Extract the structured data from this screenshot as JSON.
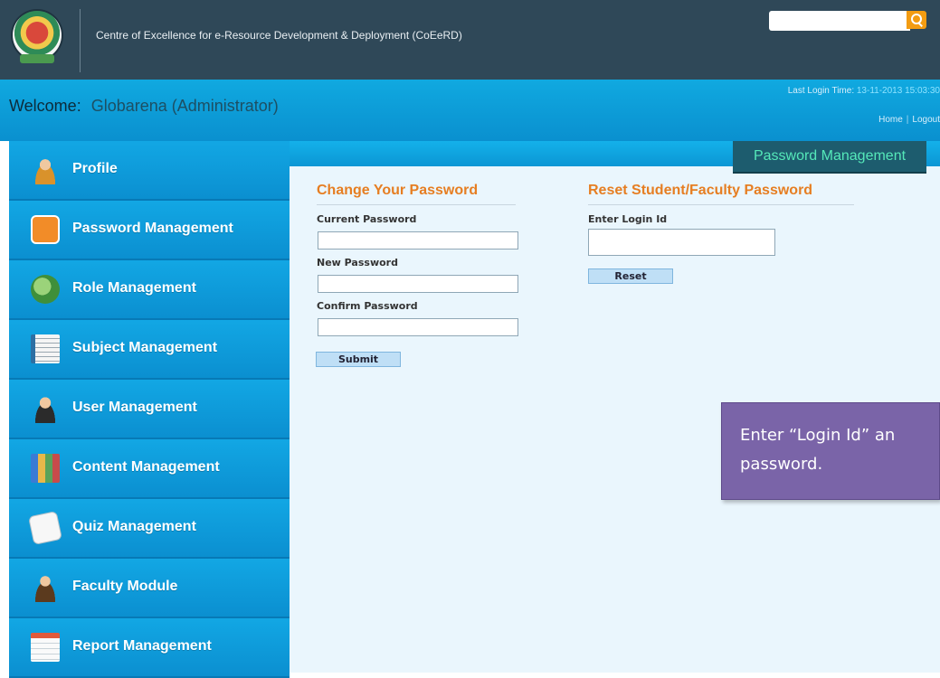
{
  "header": {
    "site_title": "Centre of Excellence for e-Resource Development & Deployment (CoEeRD)",
    "search_placeholder": "",
    "search_icon": "magnifier-icon",
    "logo_icon": "university-seal-icon"
  },
  "welcome": {
    "label": "Welcome:",
    "user": "Globarena (Administrator)",
    "last_login_label": "Last Login Time:",
    "last_login_time": "13-11-2013 15:03:30",
    "home_link": "Home",
    "separator": "|",
    "logout_link": "Logout"
  },
  "sidebar": {
    "items": [
      {
        "label": "Profile",
        "icon": "user-icon"
      },
      {
        "label": "Password Management",
        "icon": "lock-icon"
      },
      {
        "label": "Role Management",
        "icon": "globe-icon"
      },
      {
        "label": "Subject Management",
        "icon": "notebook-icon"
      },
      {
        "label": "User Management",
        "icon": "person-icon"
      },
      {
        "label": "Content Management",
        "icon": "books-icon"
      },
      {
        "label": "Quiz Management",
        "icon": "paper-icon"
      },
      {
        "label": "Faculty Module",
        "icon": "teacher-icon"
      },
      {
        "label": "Report Management",
        "icon": "report-icon"
      }
    ]
  },
  "main": {
    "active_tab": "Password Management",
    "change_password": {
      "title": "Change Your Password",
      "current_label": "Current Password",
      "new_label": "New Password",
      "confirm_label": "Confirm Password",
      "submit_label": "Submit"
    },
    "reset_password": {
      "title": "Reset Student/Faculty Password",
      "login_label": "Enter Login Id",
      "reset_label": "Reset"
    }
  },
  "callout": {
    "line1": "Enter “Login Id” an",
    "line2": "password."
  },
  "colors": {
    "header_bg": "#2f4858",
    "accent_blue": "#0b96d4",
    "section_title": "#e67e22",
    "callout_bg": "#7a64a8"
  }
}
